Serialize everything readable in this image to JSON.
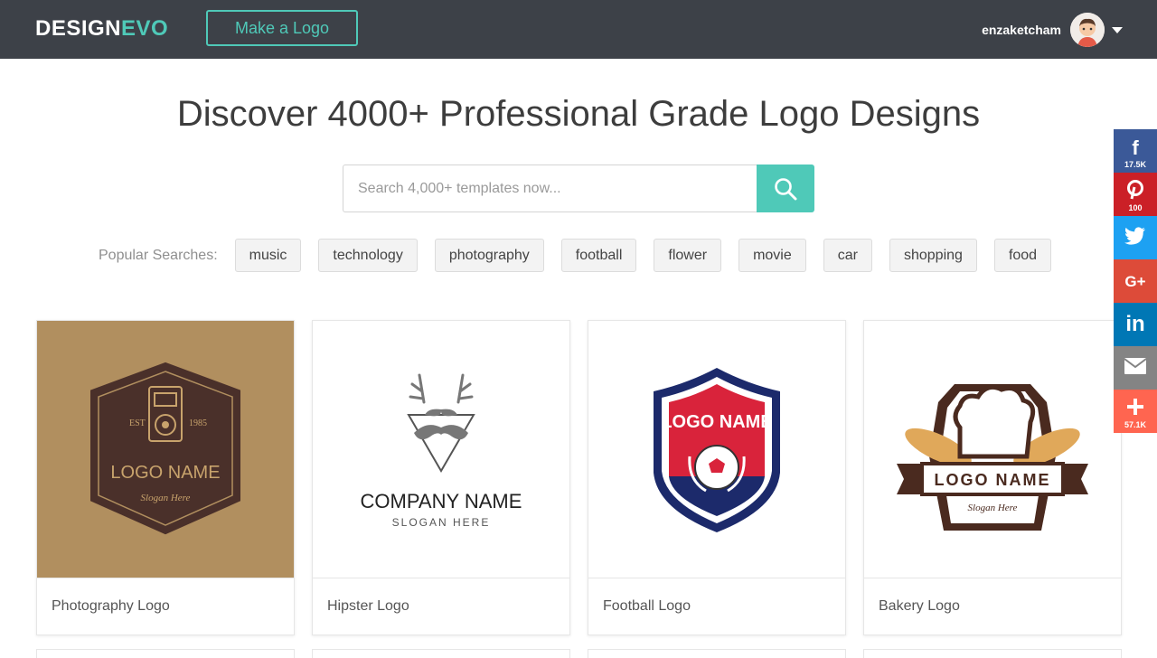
{
  "header": {
    "brand_part1": "DESIGN",
    "brand_part2": "EVO",
    "make_logo_label": "Make a Logo",
    "username": "enzaketcham"
  },
  "main": {
    "headline": "Discover 4000+ Professional Grade Logo Designs",
    "search_placeholder": "Search 4,000+ templates now...",
    "popular_label": "Popular Searches:",
    "tags": [
      "music",
      "technology",
      "photography",
      "football",
      "flower",
      "movie",
      "car",
      "shopping",
      "food"
    ]
  },
  "cards": [
    {
      "caption": "Photography Logo",
      "art": {
        "est": "EST",
        "year": "1985",
        "name": "LOGO NAME",
        "slogan": "Slogan Here"
      }
    },
    {
      "caption": "Hipster Logo",
      "art": {
        "name": "COMPANY NAME",
        "slogan": "SLOGAN HERE"
      }
    },
    {
      "caption": "Football Logo",
      "art": {
        "name": "LOGO NAME"
      }
    },
    {
      "caption": "Bakery Logo",
      "art": {
        "name": "LOGO NAME",
        "slogan": "Slogan Here"
      }
    }
  ],
  "social": {
    "facebook": {
      "icon": "facebook-icon",
      "count": "17.5K",
      "color": "#3b5998"
    },
    "pinterest": {
      "icon": "pinterest-icon",
      "count": "100",
      "color": "#cb2027"
    },
    "twitter": {
      "icon": "twitter-icon",
      "color": "#1da1f2"
    },
    "googleplus": {
      "icon": "google-plus-icon",
      "label": "G+",
      "color": "#dd4b39"
    },
    "linkedin": {
      "icon": "linkedin-icon",
      "label": "in",
      "color": "#0077b5"
    },
    "email": {
      "icon": "email-icon",
      "color": "#848484"
    },
    "more": {
      "icon": "plus-icon",
      "count": "57.1K",
      "color": "#ff6550"
    }
  },
  "colors": {
    "header_bg": "#3d4148",
    "accent": "#4fc9b8"
  }
}
